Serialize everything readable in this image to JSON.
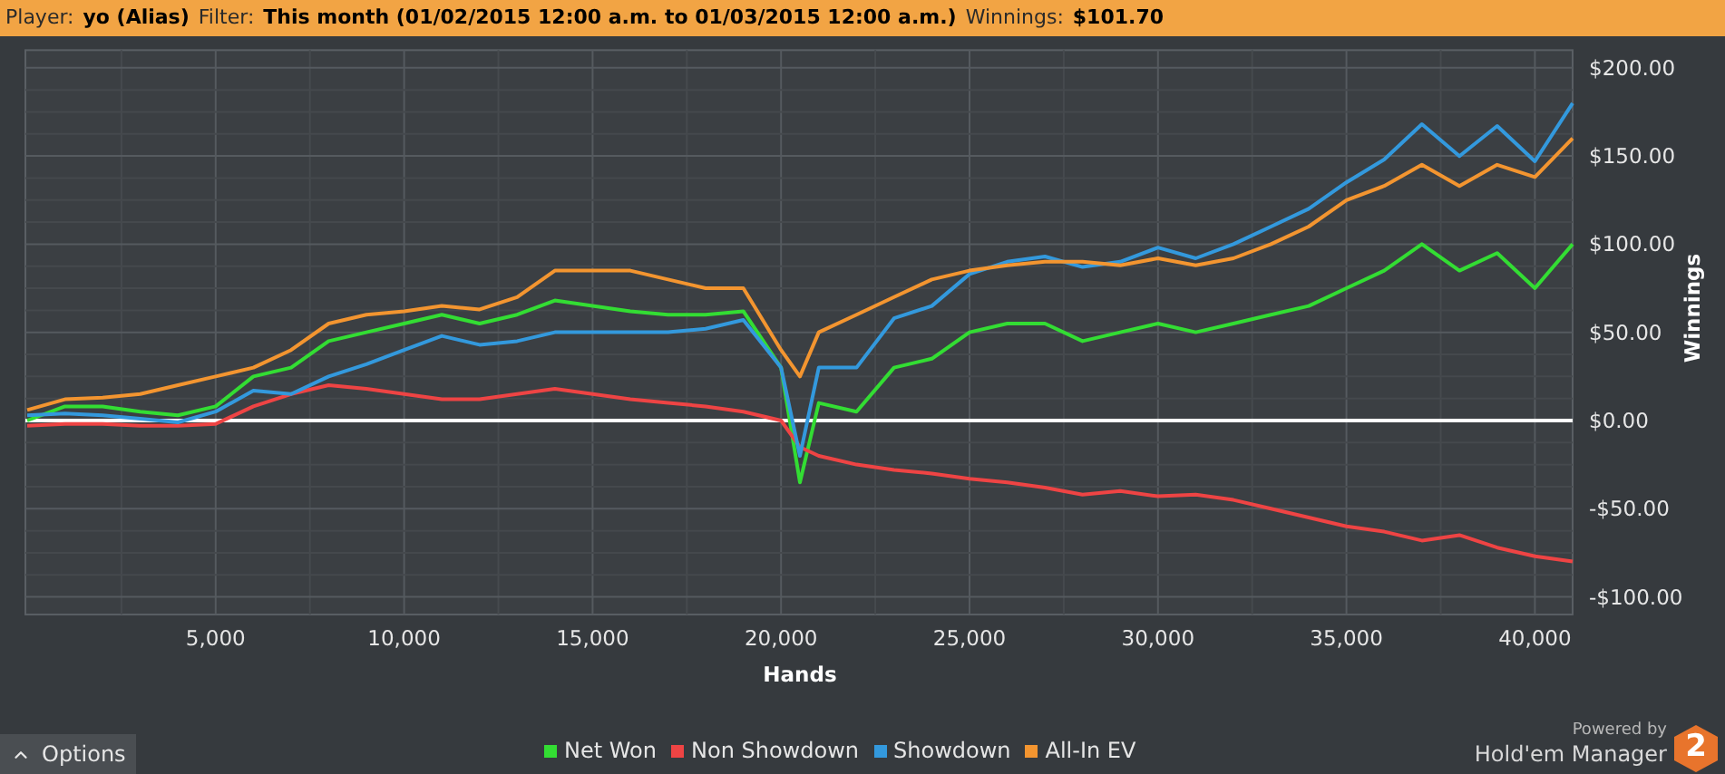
{
  "header": [
    {
      "label": "Player:",
      "value": "yo (Alias)"
    },
    {
      "label": "Filter:",
      "value": "This month (01/02/2015 12:00 a.m. to 01/03/2015 12:00 a.m.)"
    },
    {
      "label": "Winnings:",
      "value": "$101.70"
    }
  ],
  "chart": {
    "chart_data": {
      "type": "line",
      "xlabel": "Hands",
      "ylabel": "Winnings",
      "x": [
        0,
        1000,
        2000,
        3000,
        4000,
        5000,
        6000,
        7000,
        8000,
        9000,
        10000,
        11000,
        12000,
        13000,
        14000,
        15000,
        16000,
        17000,
        18000,
        19000,
        20000,
        20500,
        21000,
        22000,
        23000,
        24000,
        25000,
        26000,
        27000,
        28000,
        29000,
        30000,
        31000,
        32000,
        33000,
        34000,
        35000,
        36000,
        37000,
        38000,
        39000,
        40000,
        41000
      ],
      "series": [
        {
          "name": "Net Won",
          "color": "#33dd33",
          "values": [
            0,
            8,
            8,
            5,
            3,
            8,
            25,
            30,
            45,
            50,
            55,
            60,
            55,
            60,
            68,
            65,
            62,
            60,
            60,
            62,
            30,
            -35,
            10,
            5,
            30,
            35,
            50,
            55,
            55,
            45,
            50,
            55,
            50,
            55,
            60,
            65,
            75,
            85,
            100,
            85,
            95,
            75,
            100
          ]
        },
        {
          "name": "Non Showdown",
          "color": "#ee4444",
          "values": [
            -3,
            -2,
            -2,
            -3,
            -3,
            -2,
            8,
            15,
            20,
            18,
            15,
            12,
            12,
            15,
            18,
            15,
            12,
            10,
            8,
            5,
            0,
            -15,
            -20,
            -25,
            -28,
            -30,
            -33,
            -35,
            -38,
            -42,
            -40,
            -43,
            -42,
            -45,
            -50,
            -55,
            -60,
            -63,
            -68,
            -65,
            -72,
            -77,
            -80
          ]
        },
        {
          "name": "Showdown",
          "color": "#3399dd",
          "values": [
            3,
            4,
            3,
            1,
            -1,
            5,
            17,
            15,
            25,
            32,
            40,
            48,
            43,
            45,
            50,
            50,
            50,
            50,
            52,
            57,
            30,
            -20,
            30,
            30,
            58,
            65,
            83,
            90,
            93,
            87,
            90,
            98,
            92,
            100,
            110,
            120,
            135,
            148,
            168,
            150,
            167,
            147,
            180
          ]
        },
        {
          "name": "All-In EV",
          "color": "#f39530",
          "values": [
            6,
            12,
            13,
            15,
            20,
            25,
            30,
            40,
            55,
            60,
            62,
            65,
            63,
            70,
            85,
            85,
            85,
            80,
            75,
            75,
            40,
            25,
            50,
            60,
            70,
            80,
            85,
            88,
            90,
            90,
            88,
            92,
            88,
            92,
            100,
            110,
            125,
            133,
            145,
            133,
            145,
            138,
            160
          ]
        }
      ],
      "xlim": [
        0,
        41000
      ],
      "ylim": [
        -110,
        210
      ],
      "grid": true,
      "xticks": [
        {
          "value": 5000,
          "label": "5,000"
        },
        {
          "value": 10000,
          "label": "10,000"
        },
        {
          "value": 15000,
          "label": "15,000"
        },
        {
          "value": 20000,
          "label": "20,000"
        },
        {
          "value": 25000,
          "label": "25,000"
        },
        {
          "value": 30000,
          "label": "30,000"
        },
        {
          "value": 35000,
          "label": "35,000"
        },
        {
          "value": 40000,
          "label": "40,000"
        }
      ],
      "yticks": [
        {
          "value": 200,
          "label": "$200.00"
        },
        {
          "value": 150,
          "label": "$150.00"
        },
        {
          "value": 100,
          "label": "$100.00"
        },
        {
          "value": 50,
          "label": "$50.00"
        },
        {
          "value": 0,
          "label": "$0.00"
        },
        {
          "value": -50,
          "label": "-$50.00"
        },
        {
          "value": -100,
          "label": "-$100.00"
        }
      ]
    }
  },
  "options_button": "Options",
  "logo": {
    "caption": "Powered by",
    "name": "Hold'em Manager",
    "badge": "2"
  }
}
